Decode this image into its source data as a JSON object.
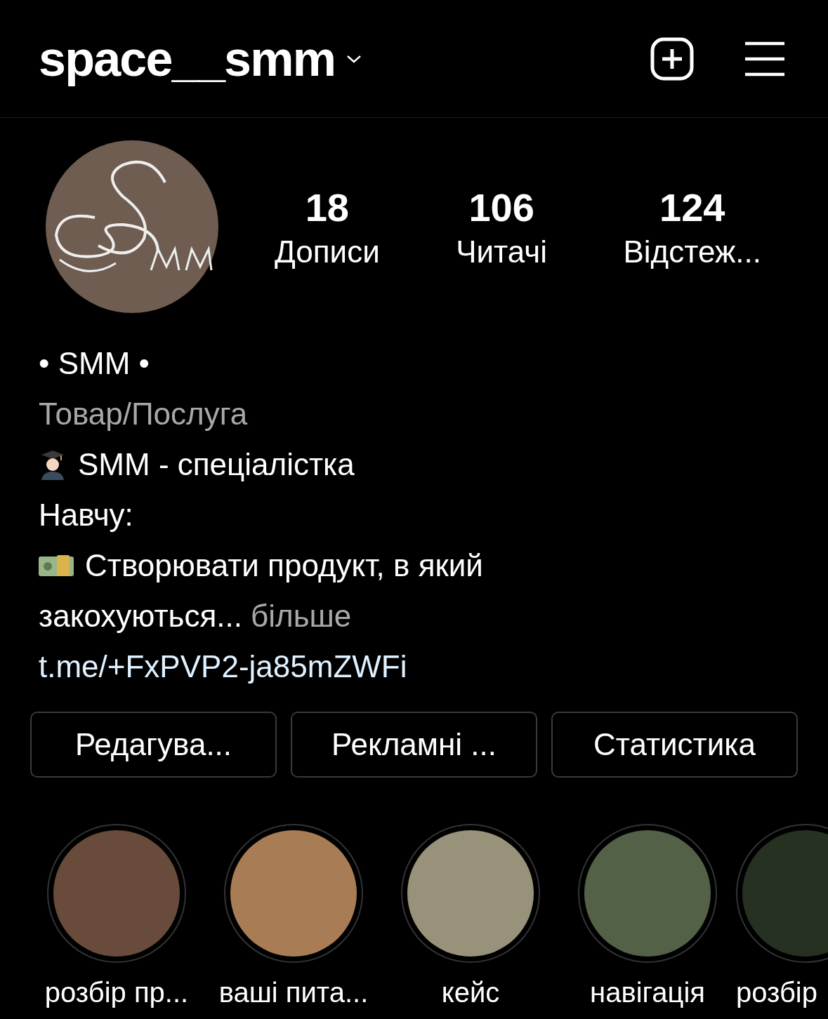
{
  "header": {
    "username": "space__smm"
  },
  "stats": [
    {
      "value": "18",
      "label": "Дописи"
    },
    {
      "value": "106",
      "label": "Читачі"
    },
    {
      "value": "124",
      "label": "Відстеж..."
    }
  ],
  "bio": {
    "name": "• SMM •",
    "category": "Товар/Послуга",
    "lines": [
      "SMM - спеціалістка",
      "Навчу:",
      "Створювати продукт, в який"
    ],
    "last_line": "закохуються...",
    "more": "більше",
    "link": "t.me/+FxPVP2-ja85mZWFi"
  },
  "buttons": [
    "Редагува...",
    "Рекламні ...",
    "Статистика"
  ],
  "highlights": [
    {
      "label": "розбір пр...",
      "color": "#684b3b"
    },
    {
      "label": "ваші пита...",
      "color": "#a87d55"
    },
    {
      "label": "кейс",
      "color": "#99927a"
    },
    {
      "label": "навігація",
      "color": "#536146"
    },
    {
      "label": "розбір",
      "color": "#273121"
    }
  ]
}
